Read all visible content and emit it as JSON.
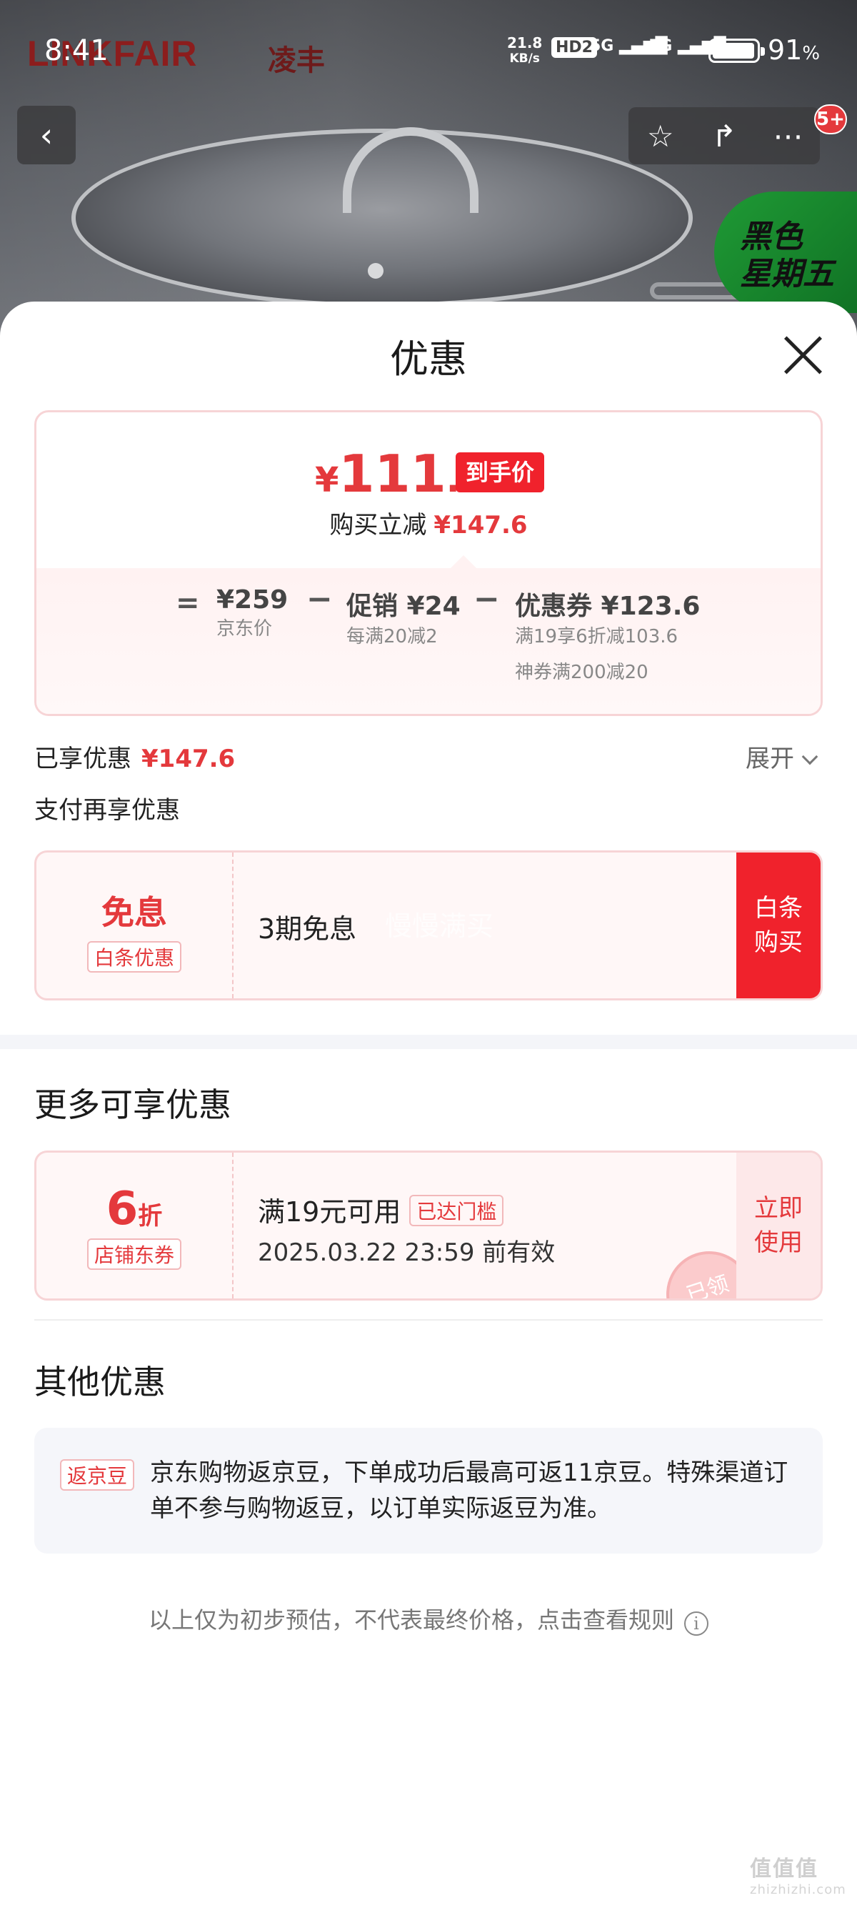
{
  "status_bar": {
    "time": "8:41",
    "net_speed_value": "21.8",
    "net_speed_unit": "KB/s",
    "hd_label": "HD2",
    "signal_1": "5G",
    "signal_2": "5G",
    "battery_percent": "91",
    "battery_unit": "%"
  },
  "background": {
    "brand_en": "LINKFAIR",
    "brand_cn": "凌丰",
    "sticker_line1": "黑色",
    "sticker_line2": "星期五",
    "cart_badge": "5+"
  },
  "sheet": {
    "title": "优惠"
  },
  "price_card": {
    "currency": "¥",
    "final_int": "111",
    "final_dec": ".4",
    "final_tag": "到手价",
    "reduce_label": "购买立减",
    "reduce_amount": "¥147.6",
    "equals": "=",
    "jd_price": "¥259",
    "jd_price_label": "京东价",
    "minus": "−",
    "promo": "促销 ¥24",
    "promo_detail": "每满20减2",
    "coupon": "优惠券 ¥123.6",
    "coupon_detail_1": "满19享6折减103.6",
    "coupon_detail_2": "神券满200减20"
  },
  "enjoyed": {
    "label": "已享优惠",
    "amount": "¥147.6",
    "expand_label": "展开"
  },
  "pay_more": {
    "title": "支付再享优惠",
    "main": "免息",
    "sub": "白条优惠",
    "desc": "3期免息",
    "ghost_text": "慢慢满买",
    "button_line1": "白条",
    "button_line2": "购买"
  },
  "more_offers": {
    "title": "更多可享优惠",
    "discount_num": "6",
    "discount_unit": "折",
    "coupon_type": "店铺东券",
    "condition": "满19元可用",
    "reached_tag": "已达门槛",
    "expiry": "2025.03.22 23:59 前有效",
    "button_line1": "立即",
    "button_line2": "使用",
    "stamp": "已领"
  },
  "other_offers": {
    "title": "其他优惠",
    "tag": "返京豆",
    "text": "京东购物返京豆，下单成功后最高可返11京豆。特殊渠道订单不参与购物返豆，以订单实际返豆为准。"
  },
  "footnote": {
    "text": "以上仅为初步预估，不代表最终价格，点击查看规则",
    "info_icon": "i"
  },
  "watermark": {
    "main": "值值值",
    "site": "zhizhizhi.com"
  }
}
